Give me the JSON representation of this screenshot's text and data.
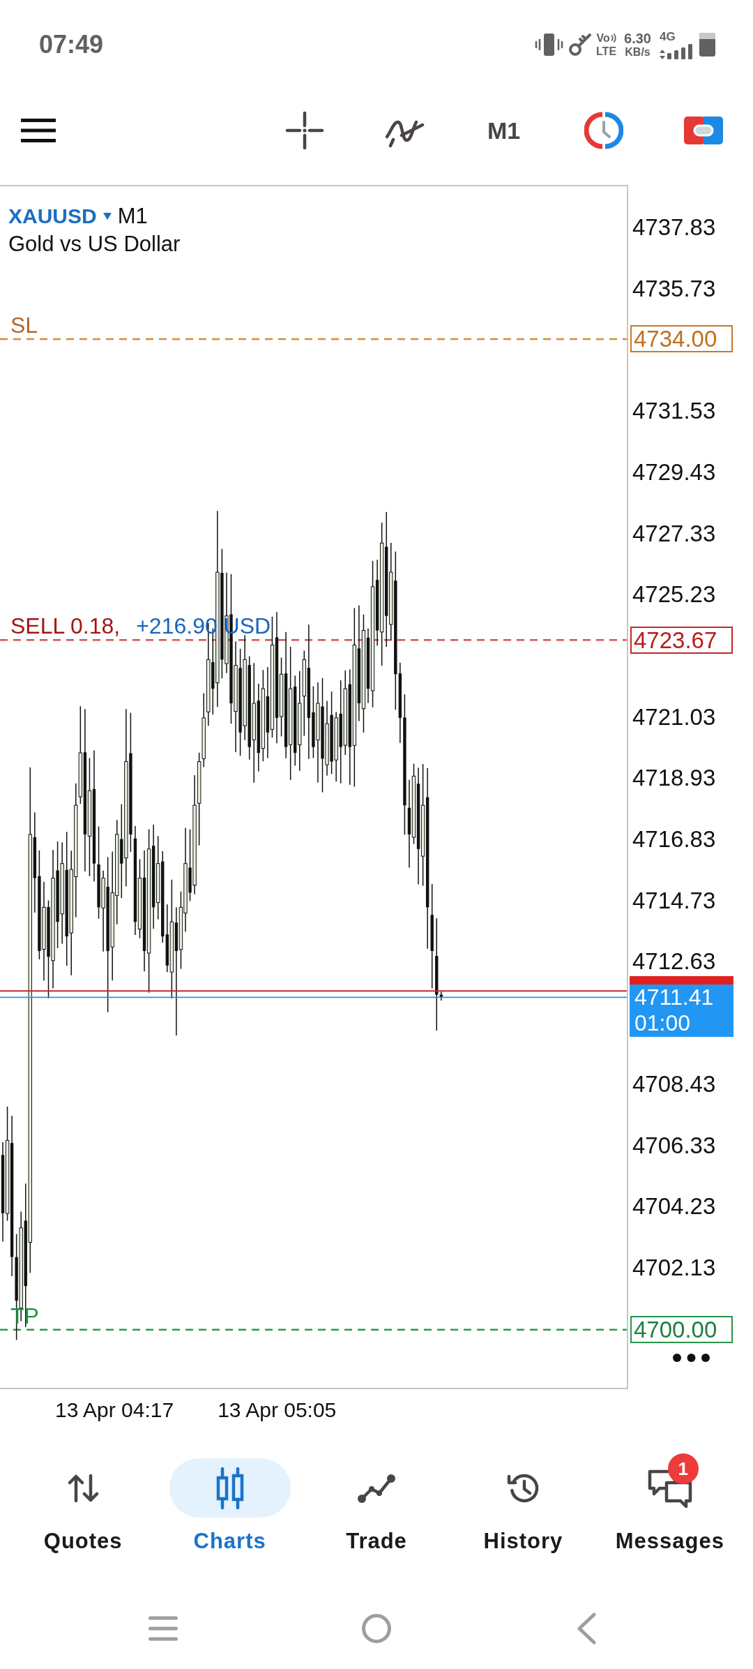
{
  "status_bar": {
    "time": "07:49",
    "volte": {
      "top": "Vo",
      "bottom": "LTE"
    },
    "network_speed": {
      "value": "6.30",
      "unit": "KB/s"
    },
    "network_type": "4G"
  },
  "toolbar": {
    "timeframe": "M1"
  },
  "chart": {
    "symbol": "XAUUSD",
    "timeframe": "M1",
    "description": "Gold vs US Dollar",
    "price_axis": [
      "4737.83",
      "4735.73",
      "4731.53",
      "4729.43",
      "4727.33",
      "4725.23",
      "4721.03",
      "4718.93",
      "4716.83",
      "4714.73",
      "4712.63",
      "4708.43",
      "4706.33",
      "4704.23",
      "4702.13"
    ],
    "levels": [
      {
        "kind": "stop_loss",
        "label": "SL",
        "price": "4734.00"
      },
      {
        "kind": "order",
        "label": "SELL 0.18,",
        "profit": "+216.90 USD",
        "price": "4723.67"
      },
      {
        "kind": "take_profit",
        "label": "TP",
        "price": "4700.00"
      }
    ],
    "current_price": {
      "price": "4711.41",
      "countdown": "01:00"
    },
    "time_axis": [
      "13 Apr 04:17",
      "13 Apr 05:05"
    ]
  },
  "bottom_nav": [
    {
      "label": "Quotes",
      "selected": false
    },
    {
      "label": "Charts",
      "selected": true
    },
    {
      "label": "Trade",
      "selected": false
    },
    {
      "label": "History",
      "selected": false
    },
    {
      "label": "Messages",
      "selected": false,
      "badge": "1"
    }
  ]
}
